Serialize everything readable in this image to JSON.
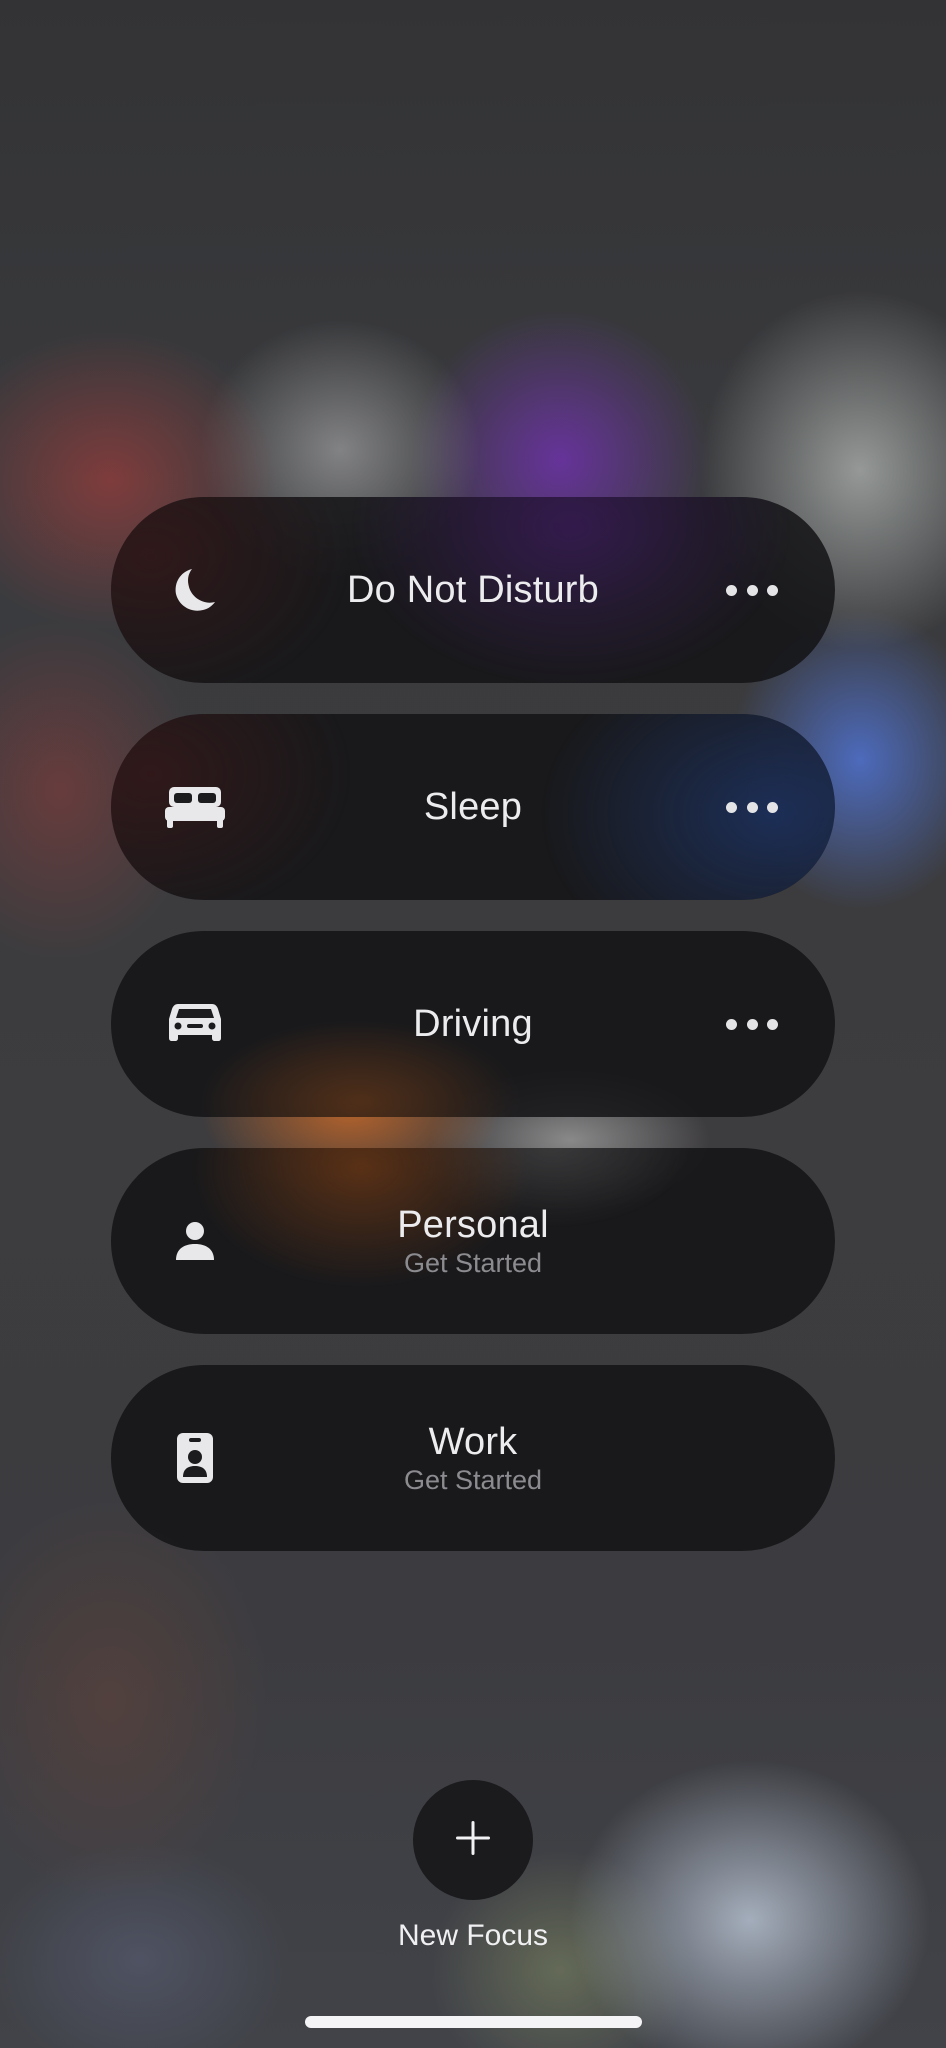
{
  "focus_modes": [
    {
      "title": "Do Not Disturb",
      "subtitle": "",
      "icon": "moon-icon",
      "has_more": true
    },
    {
      "title": "Sleep",
      "subtitle": "",
      "icon": "bed-icon",
      "has_more": true
    },
    {
      "title": "Driving",
      "subtitle": "",
      "icon": "car-icon",
      "has_more": true
    },
    {
      "title": "Personal",
      "subtitle": "Get Started",
      "icon": "person-icon",
      "has_more": false
    },
    {
      "title": "Work",
      "subtitle": "Get Started",
      "icon": "id-badge-icon",
      "has_more": false
    }
  ],
  "new_focus": {
    "label": "New Focus",
    "icon": "plus-icon"
  },
  "colors": {
    "row_background": "#141416",
    "text_primary": "#ececee",
    "text_secondary": "#8c8c90"
  }
}
